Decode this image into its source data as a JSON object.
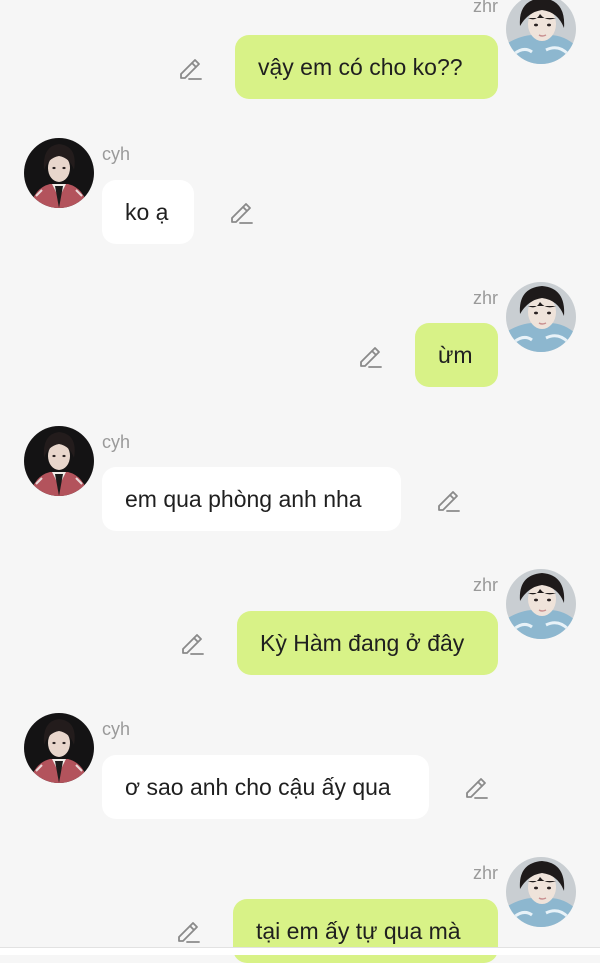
{
  "participants": {
    "left": "cyh",
    "right": "zhr"
  },
  "messages": [
    {
      "sender": "zhr",
      "text": "vậy em có cho ko??"
    },
    {
      "sender": "cyh",
      "text": "ko ạ"
    },
    {
      "sender": "zhr",
      "text": "ừm"
    },
    {
      "sender": "cyh",
      "text": "em qua phòng anh nha"
    },
    {
      "sender": "zhr",
      "text": "Kỳ Hàm đang ở đây"
    },
    {
      "sender": "cyh",
      "text": "ơ sao anh cho cậu ấy qua"
    },
    {
      "sender": "zhr",
      "text": "tại em ấy tự qua mà"
    }
  ],
  "icons": {
    "edit": "pencil-icon",
    "avatar_left": "avatar-cyh",
    "avatar_right": "avatar-zhr"
  },
  "colors": {
    "background": "#f6f6f6",
    "incoming_bubble": "#ffffff",
    "outgoing_bubble": "#d8f287",
    "name_text": "#9a9a9a",
    "message_text": "#1f1f1f"
  }
}
